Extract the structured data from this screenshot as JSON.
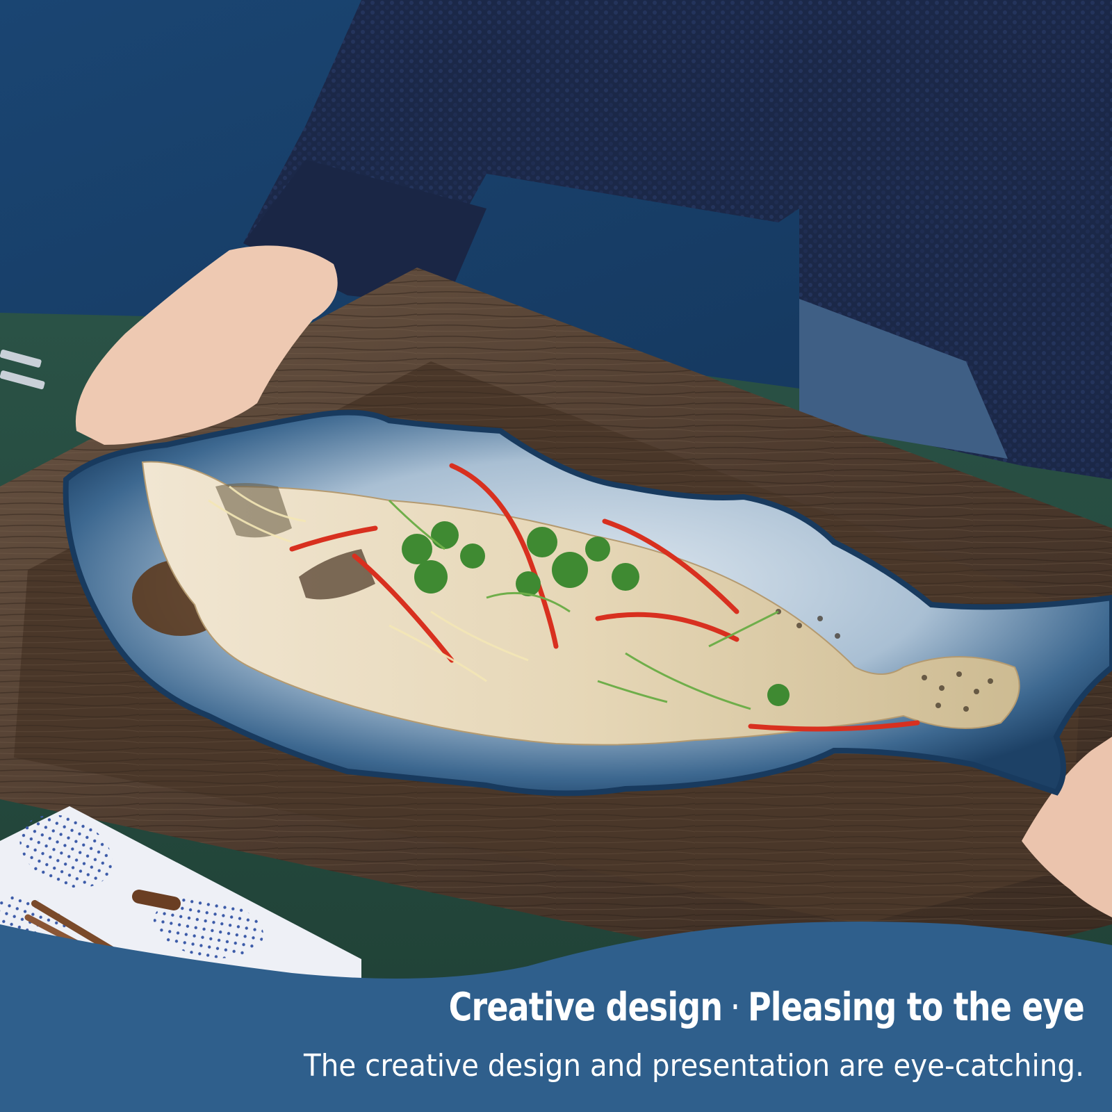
{
  "banner": {
    "headline_left": "Creative design",
    "headline_sep": "·",
    "headline_right": "Pleasing to the eye",
    "subline": "The creative design and presentation are eye-catching."
  },
  "colors": {
    "wall": "#1e4a73",
    "sweater": "#1c2a4d",
    "tray_wood": "#5a4535",
    "plate_blue": "#27507c",
    "banner": "#2f5f8c",
    "table_green": "#24493d"
  }
}
